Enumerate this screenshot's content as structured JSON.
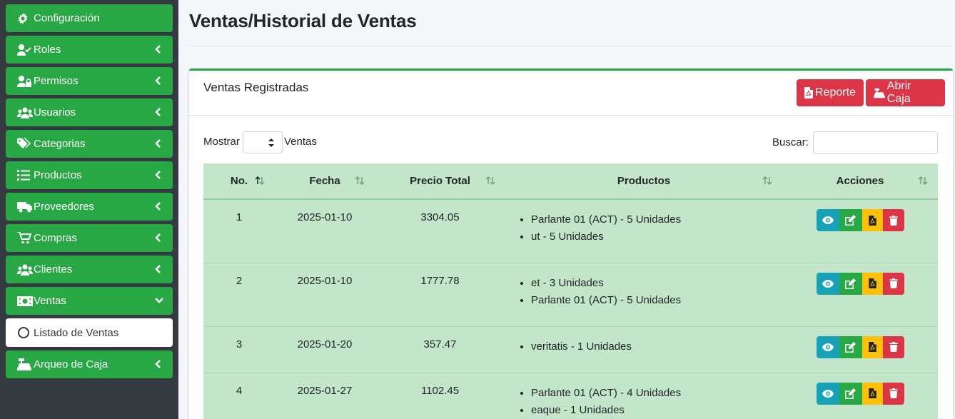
{
  "sidebar": {
    "items": [
      {
        "label": "Configuración",
        "icon": "gear-icon",
        "has_chevron": false
      },
      {
        "label": "Roles",
        "icon": "user-check-icon",
        "has_chevron": true
      },
      {
        "label": "Permisos",
        "icon": "user-lock-icon",
        "has_chevron": true
      },
      {
        "label": "Usuarios",
        "icon": "users-icon",
        "has_chevron": true
      },
      {
        "label": "Categorias",
        "icon": "tags-icon",
        "has_chevron": true
      },
      {
        "label": "Productos",
        "icon": "list-icon",
        "has_chevron": true
      },
      {
        "label": "Proveedores",
        "icon": "truck-icon",
        "has_chevron": true
      },
      {
        "label": "Compras",
        "icon": "cart-plus-icon",
        "has_chevron": true
      },
      {
        "label": "Clientes",
        "icon": "users-icon",
        "has_chevron": true
      },
      {
        "label": "Ventas",
        "icon": "money-bill-icon",
        "expanded": true
      },
      {
        "label": "Arqueo de Caja",
        "icon": "cash-register-icon",
        "has_chevron": true
      }
    ],
    "sub_item": {
      "label": "Listado de Ventas",
      "icon": "circle-icon"
    }
  },
  "header": {
    "title": "Ventas/Historial de Ventas"
  },
  "card": {
    "title": "Ventas Registradas",
    "buttons": {
      "report": "Reporte",
      "open_cash": "Abrir Caja"
    },
    "controls": {
      "show_label": "Mostrar",
      "show_after": "Ventas",
      "show_value": "",
      "search_label": "Buscar:",
      "search_value": ""
    },
    "table": {
      "columns": [
        "No.",
        "Fecha",
        "Precio Total",
        "Productos",
        "Acciones"
      ],
      "rows": [
        {
          "no": "1",
          "fecha": "2025-01-10",
          "total": "3304.05",
          "productos": [
            "Parlante 01 (ACT) - 5 Unidades",
            "ut - 5 Unidades"
          ]
        },
        {
          "no": "2",
          "fecha": "2025-01-10",
          "total": "1777.78",
          "productos": [
            "et - 3 Unidades",
            "Parlante 01 (ACT) - 5 Unidades"
          ]
        },
        {
          "no": "3",
          "fecha": "2025-01-20",
          "total": "357.47",
          "productos": [
            "veritatis - 1 Unidades"
          ]
        },
        {
          "no": "4",
          "fecha": "2025-01-27",
          "total": "1102.45",
          "productos": [
            "Parlante 01 (ACT) - 4 Unidades",
            "eaque - 1 Unidades"
          ]
        }
      ]
    }
  },
  "colors": {
    "sidebar_bg": "#343a40",
    "nav_green": "#28a745",
    "danger": "#dc3545",
    "info": "#17a2b8",
    "warning": "#ffc107",
    "row_green": "#c3e6cb"
  }
}
